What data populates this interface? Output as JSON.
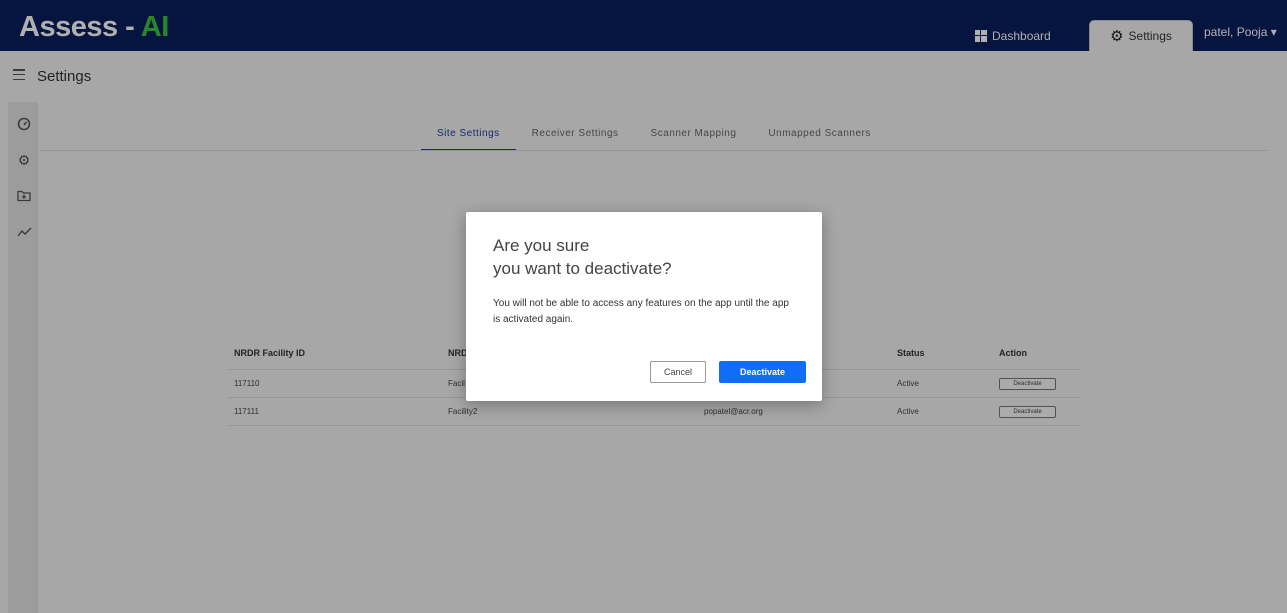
{
  "header": {
    "brand_main": "Assess - ",
    "brand_accent": "AI",
    "nav": {
      "dashboard": "Dashboard",
      "settings": "Settings"
    },
    "user": "patel, Pooja ▾",
    "colors": {
      "bar": "#0a1e5e",
      "accent": "#3cc43c"
    }
  },
  "page": {
    "title": "Settings"
  },
  "sidebar": {
    "icons": [
      "speedometer-icon",
      "gear-icon",
      "folder-plus-icon",
      "trend-chart-icon"
    ]
  },
  "tabs": [
    "Site Settings",
    "Receiver Settings",
    "Scanner Mapping",
    "Unmapped Scanners"
  ],
  "active_tab": "Site Settings",
  "table": {
    "headers": [
      "NRDR Facility ID",
      "NRD",
      "",
      "Status",
      "Action"
    ],
    "rows": [
      {
        "id": "117110",
        "facility": "Facil",
        "email": "",
        "status": "Active",
        "action": "Deactivate"
      },
      {
        "id": "117111",
        "facility": "Facility2",
        "email": "popatel@acr.org",
        "status": "Active",
        "action": "Deactivate"
      }
    ]
  },
  "dialog": {
    "title_line1": "Are you sure",
    "title_line2": "you want to deactivate?",
    "message": "You will not be able to access any features on the app until the app is activated again.",
    "cancel_label": "Cancel",
    "confirm_label": "Deactivate",
    "confirm_color": "#0f6ef5"
  }
}
